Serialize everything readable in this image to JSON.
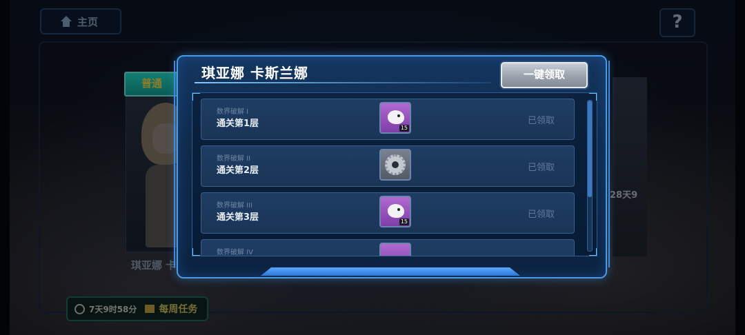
{
  "background": {
    "home_label": "主页",
    "help_label": "?",
    "difficulty_badge": "普通",
    "character_name": "琪亚娜 卡斯兰娜",
    "right_timer": "28天9",
    "weekly_timer": "7天9时58分",
    "weekly_label": "每周任务"
  },
  "modal": {
    "title": "琪亚娜 卡斯兰娜",
    "claim_all_label": "一键领取",
    "rewards": [
      {
        "category": "数界破解 I",
        "task": "通关第1层",
        "status": "已领取",
        "item_icon": "white-bird-icon",
        "count": "15"
      },
      {
        "category": "数界破解 II",
        "task": "通关第2层",
        "status": "已领取",
        "item_icon": "gear-core-icon",
        "count": ""
      },
      {
        "category": "数界破解 III",
        "task": "通关第3层",
        "status": "已领取",
        "item_icon": "white-bird-icon",
        "count": "15"
      },
      {
        "category": "数界破解 IV",
        "task": "",
        "status": "",
        "item_icon": "purple-item-icon",
        "count": ""
      }
    ]
  },
  "colors": {
    "modal_border": "#4b9ae5",
    "badge_teal": "#25e3cf",
    "badge_text": "#ffe54a",
    "claimed_text": "#62789a"
  }
}
